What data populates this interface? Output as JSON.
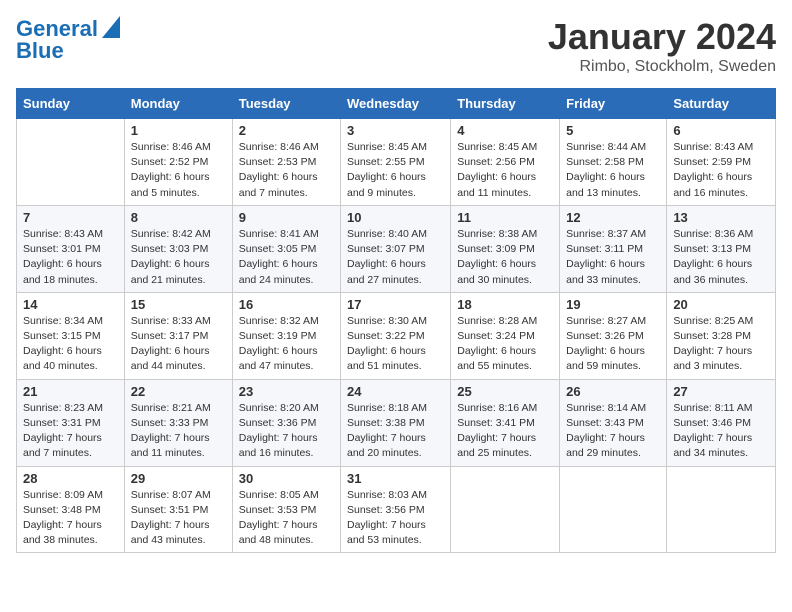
{
  "header": {
    "logo_line1": "General",
    "logo_line2": "Blue",
    "month_title": "January 2024",
    "subtitle": "Rimbo, Stockholm, Sweden"
  },
  "weekdays": [
    "Sunday",
    "Monday",
    "Tuesday",
    "Wednesday",
    "Thursday",
    "Friday",
    "Saturday"
  ],
  "weeks": [
    [
      {
        "day": "",
        "info": ""
      },
      {
        "day": "1",
        "info": "Sunrise: 8:46 AM\nSunset: 2:52 PM\nDaylight: 6 hours\nand 5 minutes."
      },
      {
        "day": "2",
        "info": "Sunrise: 8:46 AM\nSunset: 2:53 PM\nDaylight: 6 hours\nand 7 minutes."
      },
      {
        "day": "3",
        "info": "Sunrise: 8:45 AM\nSunset: 2:55 PM\nDaylight: 6 hours\nand 9 minutes."
      },
      {
        "day": "4",
        "info": "Sunrise: 8:45 AM\nSunset: 2:56 PM\nDaylight: 6 hours\nand 11 minutes."
      },
      {
        "day": "5",
        "info": "Sunrise: 8:44 AM\nSunset: 2:58 PM\nDaylight: 6 hours\nand 13 minutes."
      },
      {
        "day": "6",
        "info": "Sunrise: 8:43 AM\nSunset: 2:59 PM\nDaylight: 6 hours\nand 16 minutes."
      }
    ],
    [
      {
        "day": "7",
        "info": "Sunrise: 8:43 AM\nSunset: 3:01 PM\nDaylight: 6 hours\nand 18 minutes."
      },
      {
        "day": "8",
        "info": "Sunrise: 8:42 AM\nSunset: 3:03 PM\nDaylight: 6 hours\nand 21 minutes."
      },
      {
        "day": "9",
        "info": "Sunrise: 8:41 AM\nSunset: 3:05 PM\nDaylight: 6 hours\nand 24 minutes."
      },
      {
        "day": "10",
        "info": "Sunrise: 8:40 AM\nSunset: 3:07 PM\nDaylight: 6 hours\nand 27 minutes."
      },
      {
        "day": "11",
        "info": "Sunrise: 8:38 AM\nSunset: 3:09 PM\nDaylight: 6 hours\nand 30 minutes."
      },
      {
        "day": "12",
        "info": "Sunrise: 8:37 AM\nSunset: 3:11 PM\nDaylight: 6 hours\nand 33 minutes."
      },
      {
        "day": "13",
        "info": "Sunrise: 8:36 AM\nSunset: 3:13 PM\nDaylight: 6 hours\nand 36 minutes."
      }
    ],
    [
      {
        "day": "14",
        "info": "Sunrise: 8:34 AM\nSunset: 3:15 PM\nDaylight: 6 hours\nand 40 minutes."
      },
      {
        "day": "15",
        "info": "Sunrise: 8:33 AM\nSunset: 3:17 PM\nDaylight: 6 hours\nand 44 minutes."
      },
      {
        "day": "16",
        "info": "Sunrise: 8:32 AM\nSunset: 3:19 PM\nDaylight: 6 hours\nand 47 minutes."
      },
      {
        "day": "17",
        "info": "Sunrise: 8:30 AM\nSunset: 3:22 PM\nDaylight: 6 hours\nand 51 minutes."
      },
      {
        "day": "18",
        "info": "Sunrise: 8:28 AM\nSunset: 3:24 PM\nDaylight: 6 hours\nand 55 minutes."
      },
      {
        "day": "19",
        "info": "Sunrise: 8:27 AM\nSunset: 3:26 PM\nDaylight: 6 hours\nand 59 minutes."
      },
      {
        "day": "20",
        "info": "Sunrise: 8:25 AM\nSunset: 3:28 PM\nDaylight: 7 hours\nand 3 minutes."
      }
    ],
    [
      {
        "day": "21",
        "info": "Sunrise: 8:23 AM\nSunset: 3:31 PM\nDaylight: 7 hours\nand 7 minutes."
      },
      {
        "day": "22",
        "info": "Sunrise: 8:21 AM\nSunset: 3:33 PM\nDaylight: 7 hours\nand 11 minutes."
      },
      {
        "day": "23",
        "info": "Sunrise: 8:20 AM\nSunset: 3:36 PM\nDaylight: 7 hours\nand 16 minutes."
      },
      {
        "day": "24",
        "info": "Sunrise: 8:18 AM\nSunset: 3:38 PM\nDaylight: 7 hours\nand 20 minutes."
      },
      {
        "day": "25",
        "info": "Sunrise: 8:16 AM\nSunset: 3:41 PM\nDaylight: 7 hours\nand 25 minutes."
      },
      {
        "day": "26",
        "info": "Sunrise: 8:14 AM\nSunset: 3:43 PM\nDaylight: 7 hours\nand 29 minutes."
      },
      {
        "day": "27",
        "info": "Sunrise: 8:11 AM\nSunset: 3:46 PM\nDaylight: 7 hours\nand 34 minutes."
      }
    ],
    [
      {
        "day": "28",
        "info": "Sunrise: 8:09 AM\nSunset: 3:48 PM\nDaylight: 7 hours\nand 38 minutes."
      },
      {
        "day": "29",
        "info": "Sunrise: 8:07 AM\nSunset: 3:51 PM\nDaylight: 7 hours\nand 43 minutes."
      },
      {
        "day": "30",
        "info": "Sunrise: 8:05 AM\nSunset: 3:53 PM\nDaylight: 7 hours\nand 48 minutes."
      },
      {
        "day": "31",
        "info": "Sunrise: 8:03 AM\nSunset: 3:56 PM\nDaylight: 7 hours\nand 53 minutes."
      },
      {
        "day": "",
        "info": ""
      },
      {
        "day": "",
        "info": ""
      },
      {
        "day": "",
        "info": ""
      }
    ]
  ]
}
